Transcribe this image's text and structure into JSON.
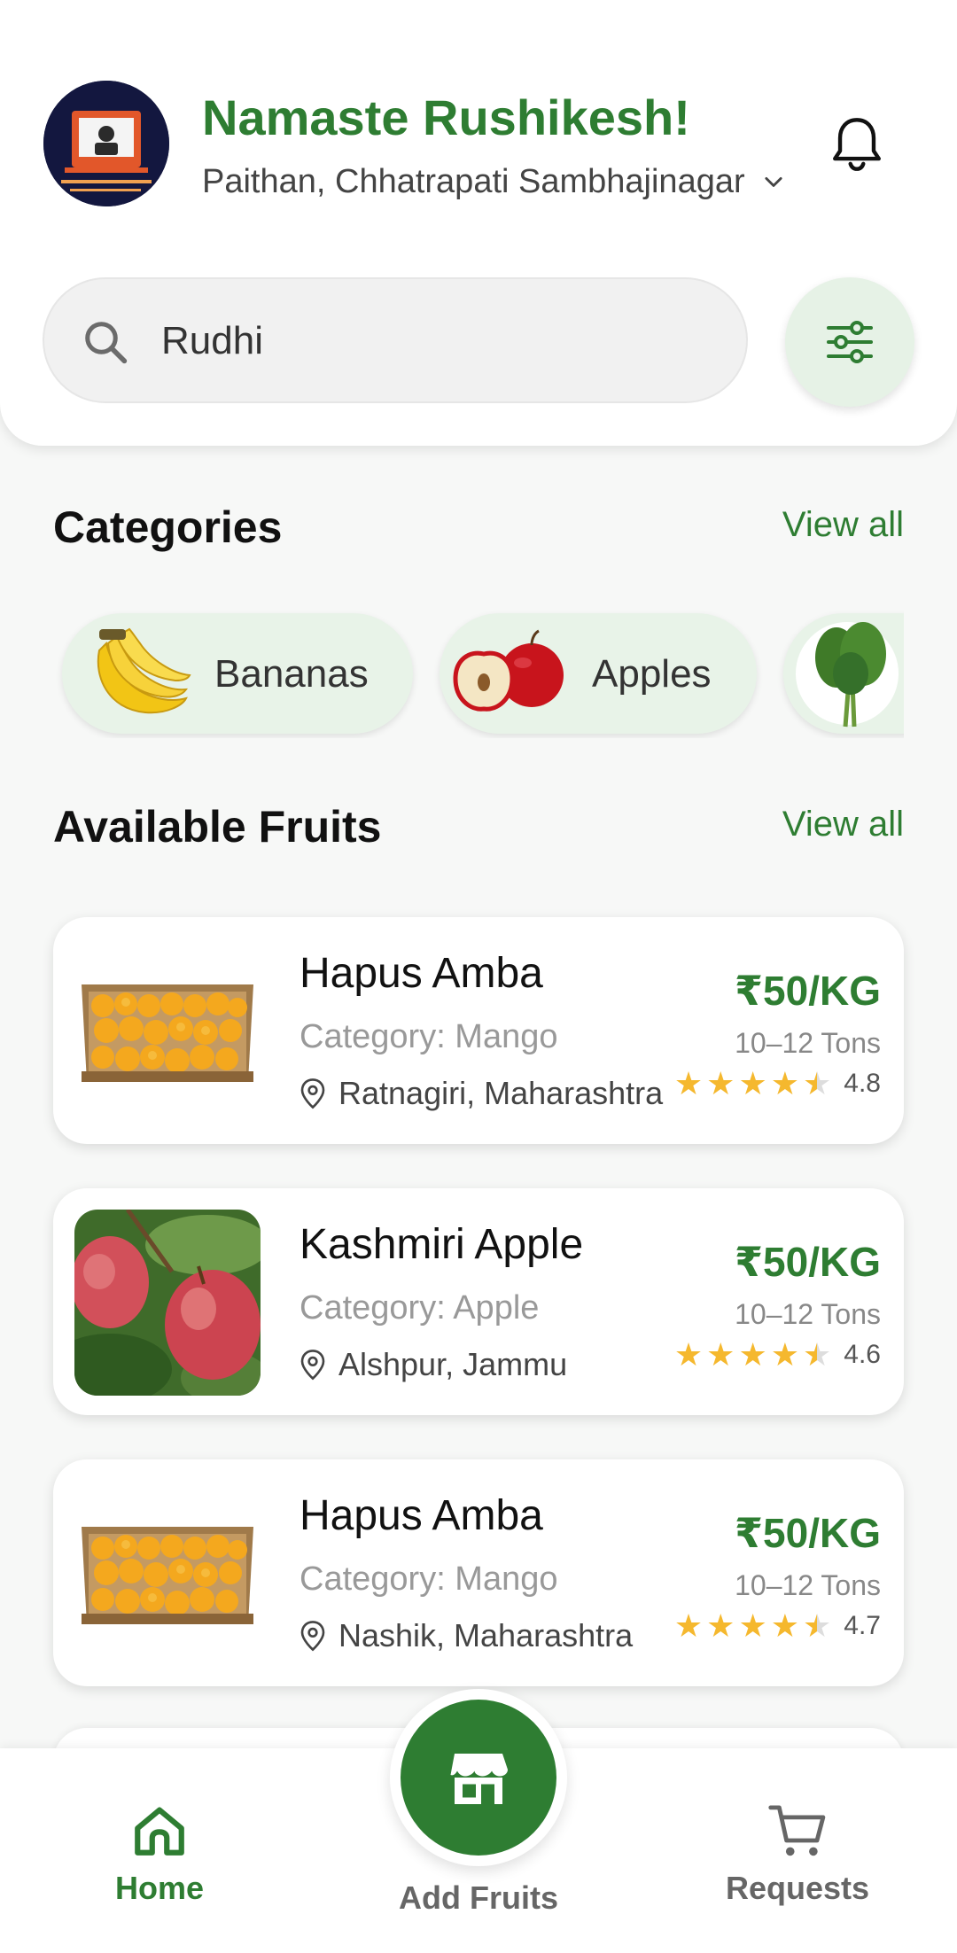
{
  "header": {
    "greeting": "Namaste Rushikesh!",
    "location": "Paithan, Chhatrapati Sambhajinagar"
  },
  "search": {
    "value": "Rudhi"
  },
  "categories": {
    "title": "Categories",
    "view_all": "View all",
    "items": [
      {
        "label": "Bananas",
        "icon": "banana-icon"
      },
      {
        "label": "Apples",
        "icon": "apple-icon"
      },
      {
        "label": "",
        "icon": "leafy-greens-icon"
      }
    ]
  },
  "fruits": {
    "title": "Available Fruits",
    "view_all": "View all",
    "items": [
      {
        "name": "Hapus Amba",
        "category": "Category: Mango",
        "location": "Ratnagiri, Maharashtra",
        "price": "₹50/KG",
        "quantity": "10–12 Tons",
        "rating": "4.8",
        "image": "mango-crate"
      },
      {
        "name": "Kashmiri Apple",
        "category": "Category: Apple",
        "location": "Alshpur, Jammu",
        "price": "₹50/KG",
        "quantity": "10–12 Tons",
        "rating": "4.6",
        "image": "apple-tree"
      },
      {
        "name": "Hapus Amba",
        "category": "Category: Mango",
        "location": "Nashik, Maharashtra",
        "price": "₹50/KG",
        "quantity": "10–12 Tons",
        "rating": "4.7",
        "image": "mango-crate"
      }
    ]
  },
  "nav": {
    "home": "Home",
    "add_fruits": "Add Fruits",
    "requests": "Requests"
  },
  "colors": {
    "primary": "#2e7d32",
    "pill_bg": "#e8f3e8",
    "star": "#f5b82e"
  }
}
